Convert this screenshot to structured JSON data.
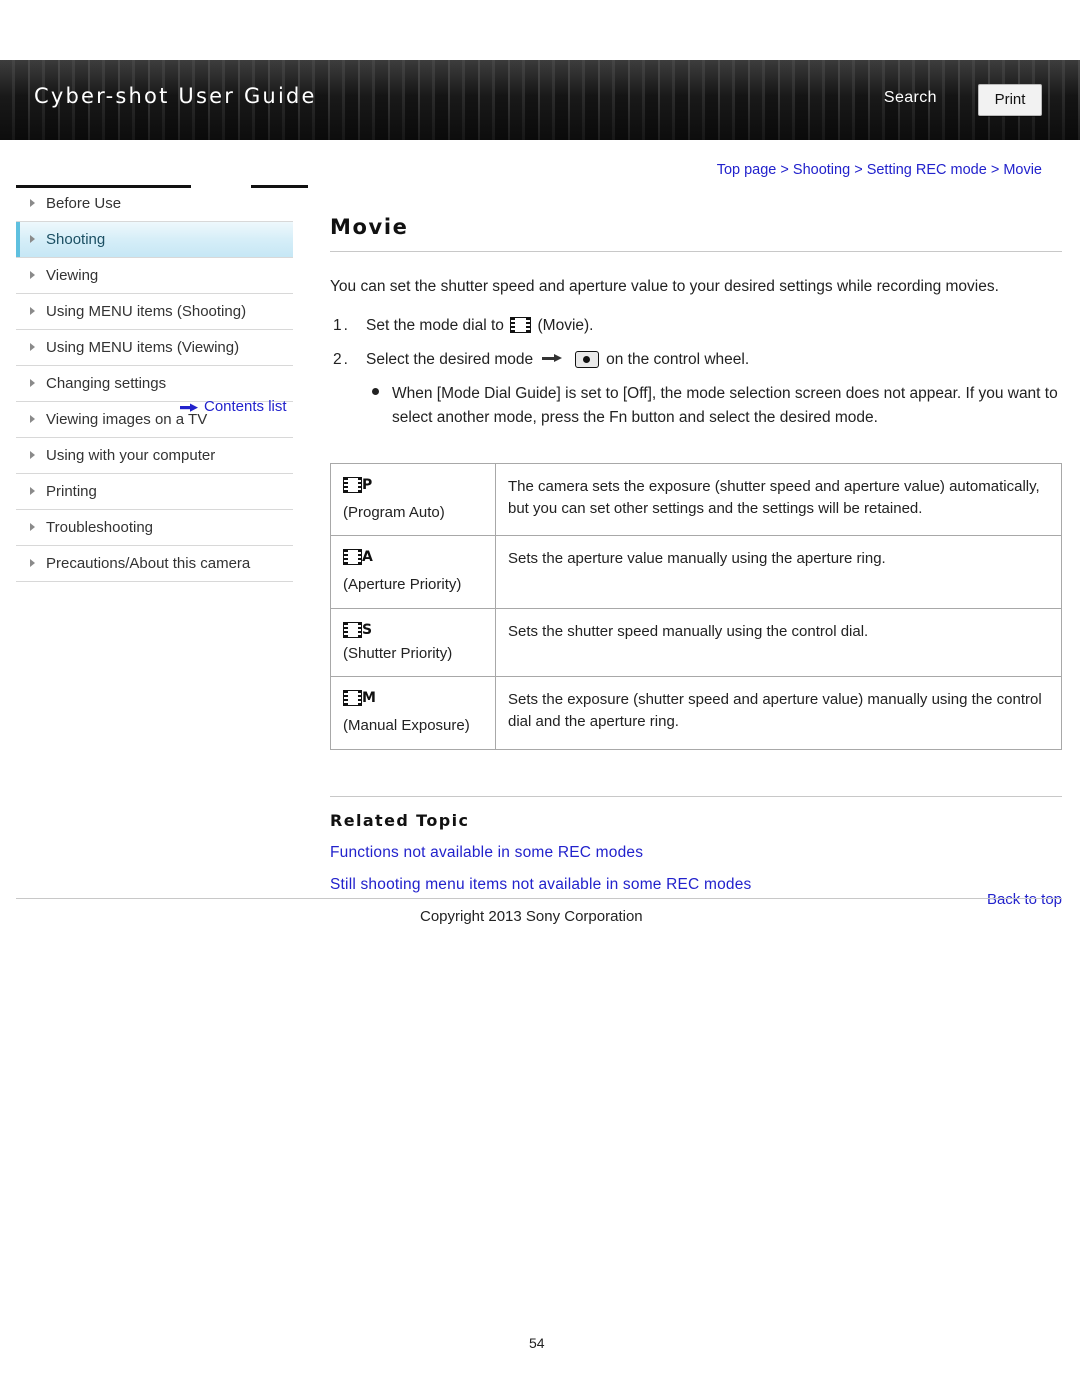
{
  "header": {
    "title": "Cyber-shot User Guide",
    "search_label": "Search",
    "print_label": "Print"
  },
  "breadcrumb": {
    "items": [
      "Top page",
      "Shooting",
      "Setting REC mode",
      "Movie"
    ],
    "separator": ">"
  },
  "sidebar": {
    "items": [
      {
        "label": "Before Use",
        "selected": false
      },
      {
        "label": "Shooting",
        "selected": true
      },
      {
        "label": "Viewing",
        "selected": false
      },
      {
        "label": "Using MENU items (Shooting)",
        "selected": false
      },
      {
        "label": "Using MENU items (Viewing)",
        "selected": false
      },
      {
        "label": "Changing settings",
        "selected": false
      },
      {
        "label": "Viewing images on a TV",
        "selected": false
      },
      {
        "label": "Using with your computer",
        "selected": false
      },
      {
        "label": "Printing",
        "selected": false
      },
      {
        "label": "Troubleshooting",
        "selected": false
      },
      {
        "label": "Precautions/About this camera",
        "selected": false
      }
    ],
    "contents_list_label": "Contents list"
  },
  "main": {
    "title": "Movie",
    "intro": "You can set the shutter speed and aperture value to your desired settings while recording movies.",
    "steps": [
      {
        "num": "1.",
        "text_before": "Set the mode dial to",
        "icon": "film-icon",
        "text_after": "(Movie)."
      },
      {
        "num": "2.",
        "text_before": "Select the desired mode",
        "icon": "arrow-then-mode-dial-icon",
        "text_after": "on the control wheel."
      }
    ],
    "note": "When [Mode Dial Guide] is set to [Off], the mode selection screen does not appear. If you want to select another mode, press the Fn button and select the desired mode.",
    "table": {
      "rows": [
        {
          "icon": "film-p-icon",
          "icon_letter": "P",
          "mode_label": "(Program Auto)",
          "description": "The camera sets the exposure (shutter speed and aperture value) automatically, but you can set other settings and the settings will be retained."
        },
        {
          "icon": "film-a-icon",
          "icon_letter": "A",
          "mode_label": "(Aperture Priority)",
          "description": "Sets the aperture value manually using the aperture ring."
        },
        {
          "icon": "film-s-icon",
          "icon_letter": "S",
          "mode_label": "(Shutter Priority)",
          "description": "Sets the shutter speed manually using the control dial."
        },
        {
          "icon": "film-m-icon",
          "icon_letter": "M",
          "mode_label": "(Manual Exposure)",
          "description": "Sets the exposure (shutter speed and aperture value) manually using the control dial and the aperture ring."
        }
      ]
    },
    "related": {
      "title": "Related Topic",
      "links": [
        "Functions not available in some REC modes",
        "Still shooting menu items not available in some REC modes"
      ]
    }
  },
  "footer": {
    "back_to_top": "Back to top",
    "copyright": "Copyright 2013 Sony Corporation",
    "page_number": "54"
  }
}
